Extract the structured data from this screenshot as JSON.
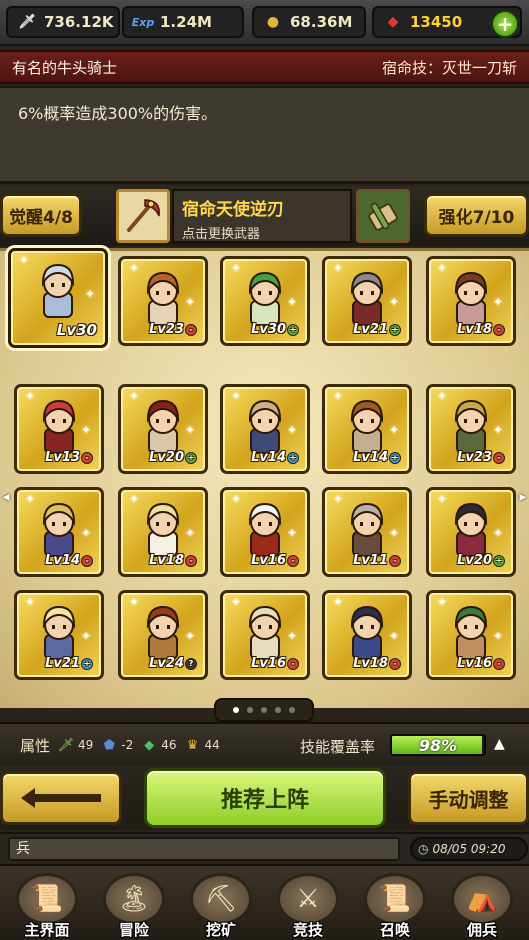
{
  "resources": {
    "attack": {
      "icon": "sword-icon",
      "value": "736.12K"
    },
    "exp": {
      "icon": "exp-icon",
      "value": "1.24M"
    },
    "gold": {
      "icon": "gold-coin-icon",
      "value": "68.36M"
    },
    "gem": {
      "icon": "ruby-gem-icon",
      "value": "13450",
      "color": "#ffcf3a"
    },
    "add_label": "+"
  },
  "hero": {
    "name": "有名的牛头骑士",
    "fate_skill": "宿命技：灭世一刀斩",
    "description": "6%概率造成300%的伤害。"
  },
  "weapon": {
    "awaken_label": "觉醒4/8",
    "enhance_label": "强化7/10",
    "name": "宿命天使逆刃",
    "hint": "点击更换武器"
  },
  "roster": [
    {
      "level": "Lv30",
      "badge": "none",
      "hair": "#cfd8e6",
      "body": "#a9bed6",
      "selected": true
    },
    {
      "level": "Lv23",
      "badge": "red",
      "hair": "#b7652a",
      "body": "#e6d3b7",
      "selected": false
    },
    {
      "level": "Lv30",
      "badge": "green",
      "hair": "#4aa046",
      "body": "#d7e6c0",
      "selected": false
    },
    {
      "level": "Lv21",
      "badge": "green",
      "hair": "#8b8b8b",
      "body": "#7a2a2a",
      "selected": false
    },
    {
      "level": "Lv18",
      "badge": "red",
      "hair": "#7a3a2a",
      "body": "#c99a9a",
      "selected": false
    },
    {
      "level": "Lv13",
      "badge": "red",
      "hair": "#d23a3a",
      "body": "#8a2424",
      "selected": false
    },
    {
      "level": "Lv20",
      "badge": "green",
      "hair": "#8a1f1f",
      "body": "#d8c8a8",
      "selected": false
    },
    {
      "level": "Lv14",
      "badge": "blue",
      "hair": "#c9b08a",
      "body": "#3e4a7a",
      "selected": false
    },
    {
      "level": "Lv14",
      "badge": "blue",
      "hair": "#a05a22",
      "body": "#c0b090",
      "selected": false
    },
    {
      "level": "Lv23",
      "badge": "red",
      "hair": "#caa74a",
      "body": "#5a6a3a",
      "selected": false
    },
    {
      "level": "Lv14",
      "badge": "red",
      "hair": "#e0c060",
      "body": "#4a4a8a",
      "selected": false
    },
    {
      "level": "Lv18",
      "badge": "red",
      "hair": "#f0e0a0",
      "body": "#f4f0e4",
      "selected": false
    },
    {
      "level": "Lv16",
      "badge": "red",
      "hair": "#f4f4f4",
      "body": "#9a2a1a",
      "selected": false
    },
    {
      "level": "Lv11",
      "badge": "red",
      "hair": "#b8b0a8",
      "body": "#6a4a3a",
      "selected": false
    },
    {
      "level": "Lv20",
      "badge": "green",
      "hair": "#2a2a3a",
      "body": "#8a2a3a",
      "selected": false
    },
    {
      "level": "Lv21",
      "badge": "blue",
      "hair": "#f0e6a0",
      "body": "#5a6aa0",
      "selected": false
    },
    {
      "level": "Lv24",
      "badge": "question",
      "hair": "#9a3a1a",
      "body": "#b07a3a",
      "selected": false
    },
    {
      "level": "Lv16",
      "badge": "red",
      "hair": "#e8dcc0",
      "body": "#e8dcc0",
      "selected": false
    },
    {
      "level": "Lv18",
      "badge": "red",
      "hair": "#2a3050",
      "body": "#3a4a8a",
      "selected": false
    },
    {
      "level": "Lv16",
      "badge": "red",
      "hair": "#3a7a3a",
      "body": "#c09060",
      "selected": false
    }
  ],
  "stats": {
    "label": "属性",
    "items": [
      {
        "icon": "sword-stat-icon",
        "value": "49"
      },
      {
        "icon": "shield-stat-icon",
        "value": "-2"
      },
      {
        "icon": "green-dragon-stat-icon",
        "value": "46"
      },
      {
        "icon": "crown-stat-icon",
        "value": "44"
      }
    ],
    "coverage_label": "技能覆盖率",
    "coverage_value": "98%",
    "coverage_fraction": 0.98
  },
  "pages": {
    "total": 5,
    "current": 1
  },
  "actions": {
    "recommend_label": "推荐上阵",
    "manual_label": "手动调整"
  },
  "chat": {
    "text": "兵",
    "clock": "08/05 09:20"
  },
  "nav": [
    {
      "icon": "map-scroll-icon",
      "label": "主界面"
    },
    {
      "icon": "island-icon",
      "label": "冒险"
    },
    {
      "icon": "pickaxe-icon",
      "label": "挖矿"
    },
    {
      "icon": "crossed-swords-icon",
      "label": "竞技"
    },
    {
      "icon": "summon-scroll-icon",
      "label": "召唤"
    },
    {
      "icon": "tent-icon",
      "label": "佣兵"
    }
  ]
}
